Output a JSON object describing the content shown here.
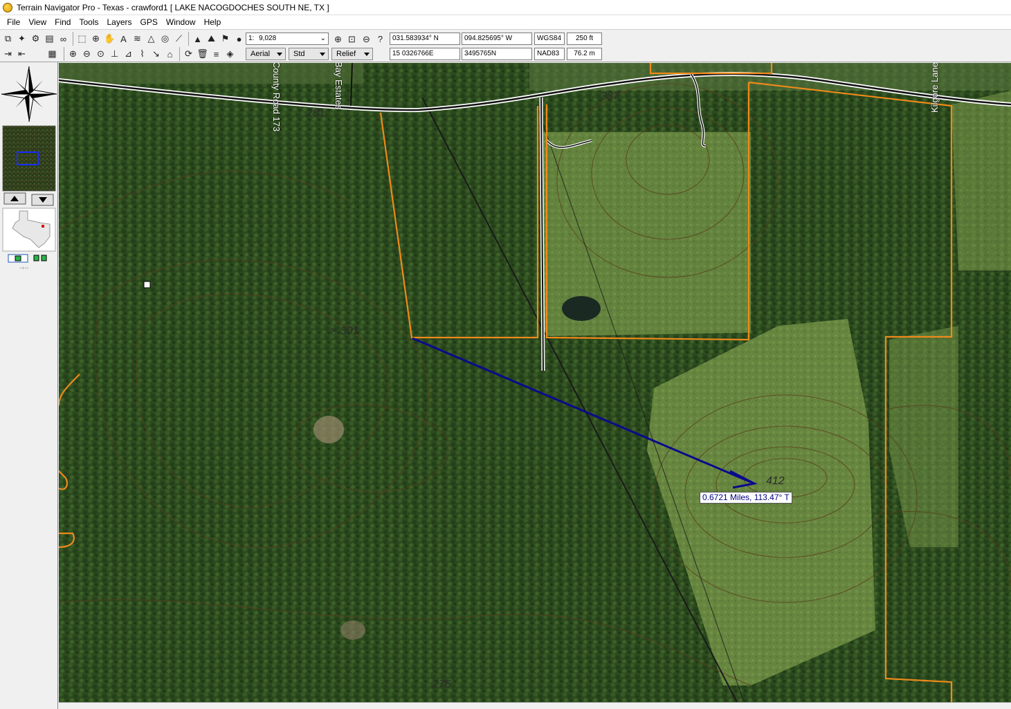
{
  "window": {
    "title": "Terrain Navigator Pro - Texas - crawford1 [ LAKE NACOGDOCHES SOUTH NE, TX ]"
  },
  "menu": [
    "File",
    "View",
    "Find",
    "Tools",
    "Layers",
    "GPS",
    "Window",
    "Help"
  ],
  "toolbar": {
    "scale_prefix": "1:",
    "scale_value": "9,028",
    "latitude": "031.583934° N",
    "longitude": "094.825695° W",
    "utm_easting": "15 0326766E",
    "utm_northing": "3495765N",
    "datum_top": "WGS84",
    "datum_bottom": "NAD83",
    "elevation_ft": "250 ft",
    "elevation_m": "76.2 m",
    "layer_aerial": "Aerial",
    "layer_std": "Std",
    "layer_relief": "Relief"
  },
  "map": {
    "measurement": "0.6721 Miles, 113.47° T",
    "road_labels": [
      "County Road 173",
      "Bay Estates",
      "Kilgore Lane"
    ],
    "elevation_labels": [
      "281",
      "337",
      "× 301",
      "412",
      "276"
    ]
  },
  "colors": {
    "boundary": "#f08a1a",
    "measure_arrow": "#0a0a8c",
    "forest": "#2f4a20",
    "field": "#6f8f45"
  }
}
